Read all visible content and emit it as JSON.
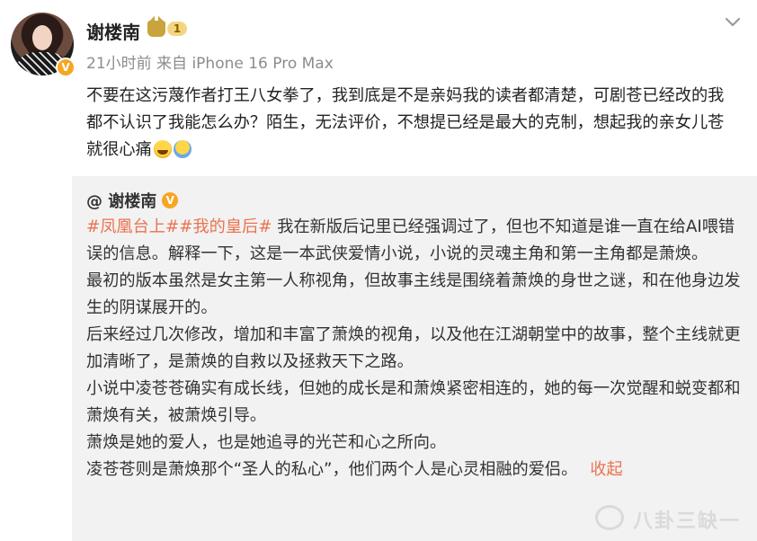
{
  "post": {
    "author": "谢楼南",
    "level": "1",
    "verified_mark": "V",
    "meta": "21小时前 来自 iPhone 16 Pro Max",
    "text": "不要在这污蔑作者打王八女拳了，我到底是不是亲妈我的读者都清楚，可剧苍已经改的我都不认识了我能怎么办？陌生，无法评价，不想提已经是最大的克制，想起我的亲女儿苍就很心痛",
    "emojis": [
      "laughing-crying-emoji",
      "praying-emoji"
    ]
  },
  "repost": {
    "mention": "@ 谢楼南",
    "verified_mark": "V",
    "tag1": "#凤凰台上#",
    "tag2": "#我的皇后#",
    "paragraphs": [
      " 我在新版后记里已经强调过了，但也不知道是谁一直在给AI喂错误的信息。解释一下，这是一本武侠爱情小说，小说的灵魂主角和第一主角都是萧焕。",
      "最初的版本虽然是女主第一人称视角，但故事主线是围绕着萧焕的身世之谜，和在他身边发生的阴谋展开的。",
      "后来经过几次修改，增加和丰富了萧焕的视角，以及他在江湖朝堂中的故事，整个主线就更加清晰了，是萧焕的自救以及拯救天下之路。",
      "小说中凌苍苍确实有成长线，但她的成长是和萧焕紧密相连的，她的每一次觉醒和蜕变都和萧焕有关，被萧焕引导。",
      "萧焕是她的爱人，也是她追寻的光芒和心之所向。",
      "凌苍苍则是萧焕那个“圣人的私心”，他们两个人是心灵相融的爱侣。"
    ],
    "collapse_label": "收起",
    "watermark": "八卦三缺一"
  },
  "colors": {
    "accent": "#eb7350",
    "verified": "#f5a623",
    "repost_bg": "#f2f2f2"
  }
}
